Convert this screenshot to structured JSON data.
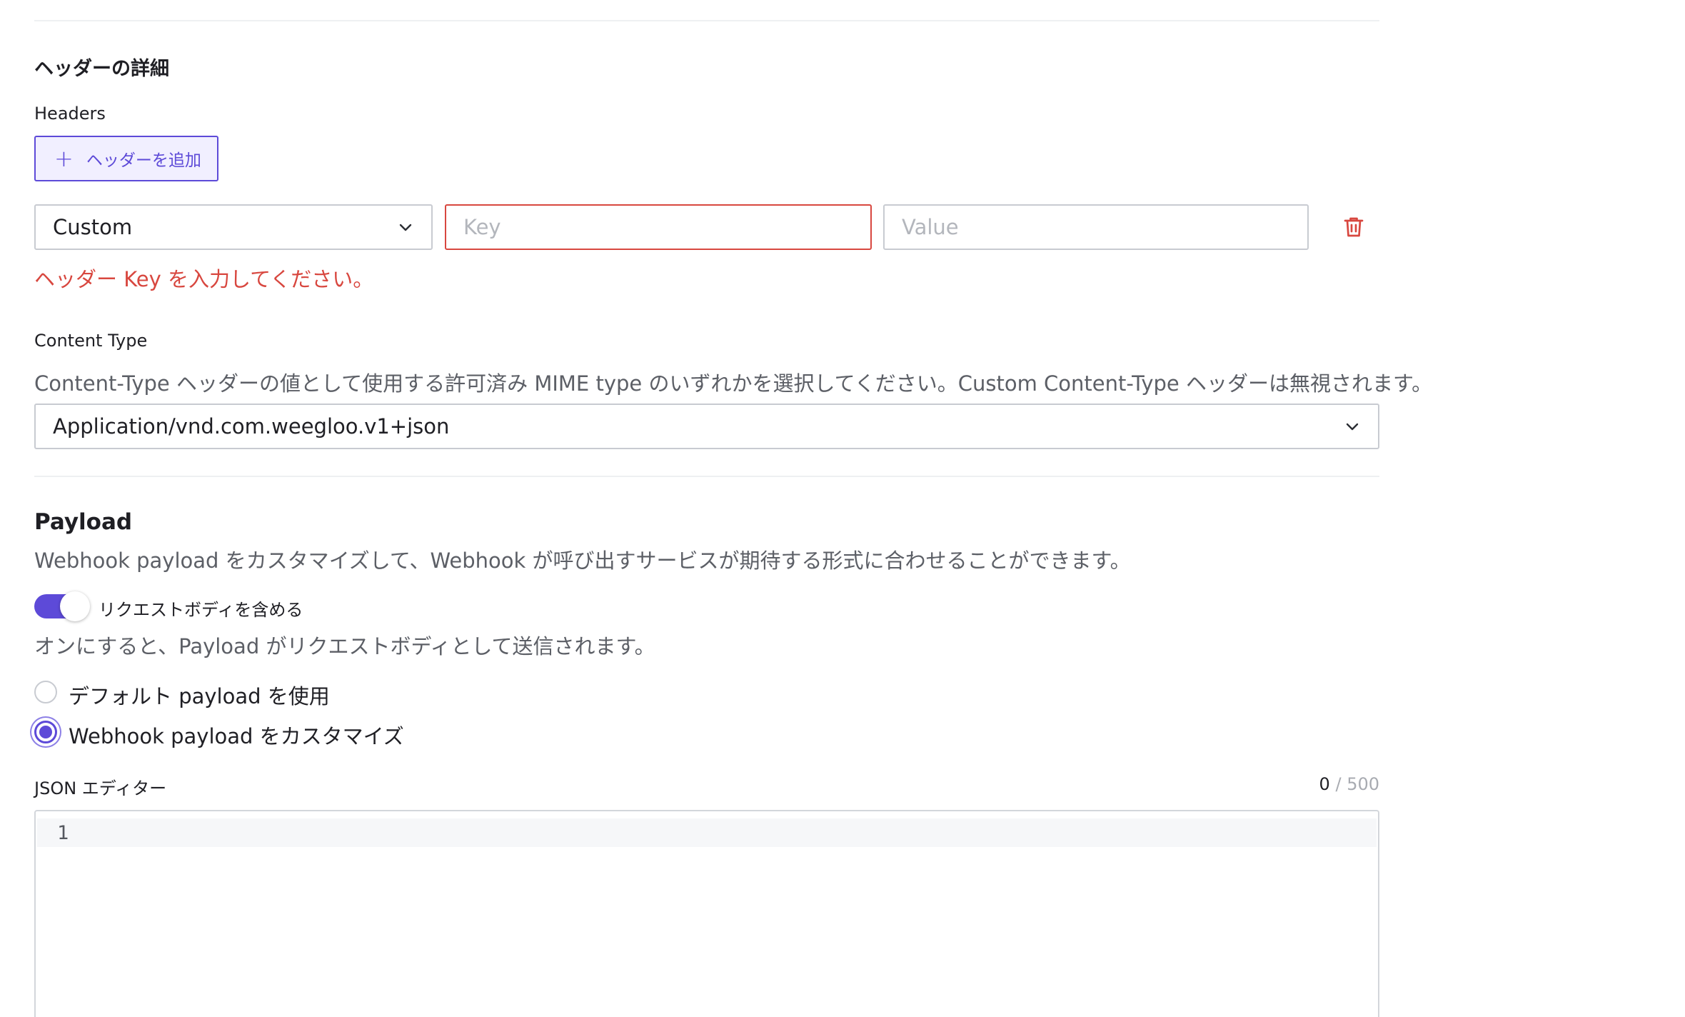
{
  "header_details": {
    "title": "ヘッダーの詳細",
    "headers_label": "Headers",
    "add_header_label": "ヘッダーを追加",
    "row": {
      "type_value": "Custom",
      "key_placeholder": "Key",
      "value_placeholder": "Value"
    },
    "key_error": "ヘッダー Key を入力してください。"
  },
  "content_type": {
    "label": "Content Type",
    "description": "Content-Type ヘッダーの値として使用する許可済み MIME type のいずれかを選択してください。Custom Content-Type ヘッダーは無視されます。",
    "selected": "Application/vnd.com.weegloo.v1+json"
  },
  "payload": {
    "title": "Payload",
    "description": "Webhook payload をカスタマイズして、Webhook が呼び出すサービスが期待する形式に合わせることができます。",
    "toggle_label": "リクエストボディを含める",
    "toggle_on": true,
    "toggle_hint": "オンにすると、Payload がリクエストボディとして送信されます。",
    "options": [
      {
        "label": "デフォルト payload を使用",
        "selected": false
      },
      {
        "label": "Webhook payload をカスタマイズ",
        "selected": true
      }
    ],
    "editor_label": "JSON エディター",
    "char_count": "0",
    "char_sep": "/",
    "char_max": "500",
    "line_number": "1"
  },
  "colors": {
    "accent": "#5d4ad8",
    "error": "#d8473f"
  }
}
